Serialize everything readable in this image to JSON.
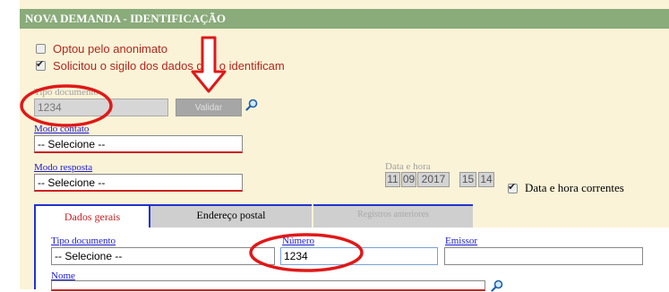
{
  "header": {
    "title": "NOVA DEMANDA - IDENTIFICAÇÃO"
  },
  "checkboxes": {
    "anonimato": {
      "label": "Optou pelo anonimato",
      "checked": false
    },
    "sigilo": {
      "label": "Solicitou o sigilo dos dados que o identificam",
      "checked": true
    }
  },
  "tipo_documento_top": {
    "label": "Tipo documento",
    "value": "1234"
  },
  "validar_button": {
    "label": "Validar"
  },
  "modo_contato": {
    "label": "Modo contato",
    "value": "-- Selecione --"
  },
  "modo_resposta": {
    "label": "Modo resposta",
    "value": "-- Selecione --"
  },
  "data_hora": {
    "label": "Data e hora",
    "day": "11",
    "month": "09",
    "year": "2017",
    "hour": "15",
    "minute": "14",
    "correntes_label": "Data e hora correntes",
    "correntes_checked": true
  },
  "tabs": [
    {
      "label": "Dados gerais",
      "state": "active"
    },
    {
      "label": "Endereço postal",
      "state": "normal"
    },
    {
      "label": "Registros anteriores",
      "state": "disabled"
    }
  ],
  "tab_form": {
    "tipo_documento": {
      "label": "Tipo documento",
      "value": "-- Selecione --"
    },
    "numero": {
      "label": "Número",
      "value": "1234"
    },
    "emissor": {
      "label": "Emissor",
      "value": ""
    },
    "nome": {
      "label": "Nome",
      "value": ""
    }
  },
  "colors": {
    "header_bg": "#8aab7a",
    "panel_bg": "#faf3d7",
    "annotation_red": "#e01818",
    "tab_border": "#2233cc"
  },
  "icons": [
    "magnifier-icon",
    "checkbox-icon",
    "down-arrow-annotation"
  ]
}
